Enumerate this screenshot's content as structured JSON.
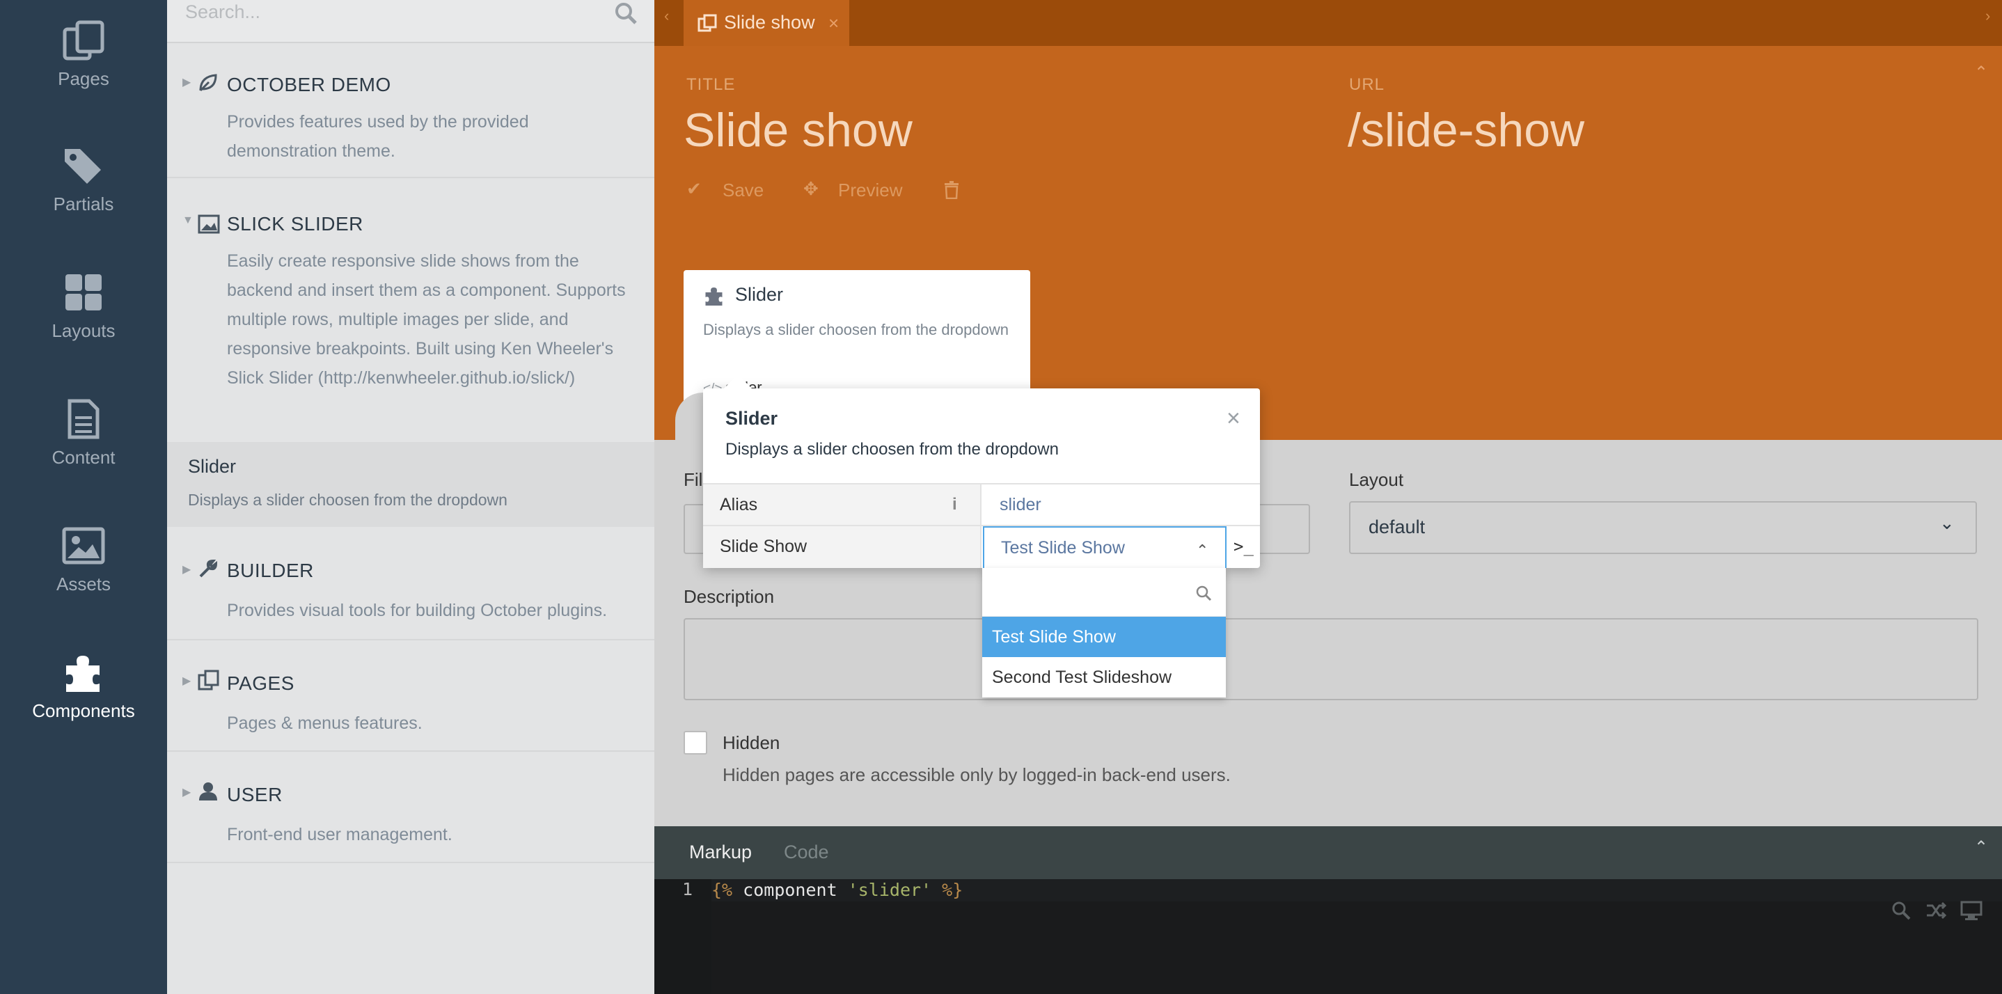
{
  "nav": {
    "items": [
      {
        "label": "Pages",
        "icon": "pages-icon"
      },
      {
        "label": "Partials",
        "icon": "tags-icon"
      },
      {
        "label": "Layouts",
        "icon": "layouts-icon"
      },
      {
        "label": "Content",
        "icon": "file-icon"
      },
      {
        "label": "Assets",
        "icon": "image-icon"
      },
      {
        "label": "Components",
        "icon": "puzzle-icon",
        "active": true
      }
    ]
  },
  "list": {
    "search_placeholder": "Search...",
    "plugins": [
      {
        "name": "OCTOBER DEMO",
        "description": "Provides features used by the provided demonstration theme."
      },
      {
        "name": "SLICK SLIDER",
        "description": "Easily create responsive slide shows from the backend and insert them as a component. Supports multiple rows, multiple images per slide, and responsive breakpoints. Built using Ken Wheeler's Slick Slider (http://kenwheeler.github.io/slick/)"
      },
      {
        "name": "BUILDER",
        "description": "Provides visual tools for building October plugins."
      },
      {
        "name": "PAGES",
        "description": "Pages & menus features."
      },
      {
        "name": "USER",
        "description": "Front-end user management."
      }
    ],
    "component": {
      "name": "Slider",
      "description": "Displays a slider choosen from the dropdown"
    }
  },
  "tab": {
    "label": "Slide show",
    "close": "×"
  },
  "editor": {
    "title_label": "TITLE",
    "title_value": "Slide show",
    "url_label": "URL",
    "url_value": "/slide-show",
    "save_label": "Save",
    "preview_label": "Preview",
    "card": {
      "name": "Slider",
      "description": "Displays a slider choosen from the dropdown",
      "alias": "slider"
    },
    "file_label": "Fil",
    "layout_label": "Layout",
    "layout_value": "default",
    "description_label": "Description",
    "hidden_label": "Hidden",
    "hidden_help": "Hidden pages are accessible only by logged-in back-end users."
  },
  "popup": {
    "title": "Slider",
    "subtitle": "Displays a slider choosen from the dropdown",
    "close": "×",
    "rows": [
      {
        "key": "Alias",
        "value": "slider"
      },
      {
        "key": "Slide Show",
        "value": "Test Slide Show"
      }
    ],
    "options": [
      "Test Slide Show",
      "Second Test Slideshow"
    ],
    "terminal": ">_"
  },
  "bottom": {
    "tabs": [
      "Markup",
      "Code"
    ],
    "line_number": "1",
    "code": {
      "open": "{%",
      "keyword": " component ",
      "string": "'slider'",
      "close": " %}"
    }
  },
  "colors": {
    "accent": "#c3651d",
    "sidebar": "#2b3e50",
    "selected": "#4ea5e6"
  }
}
